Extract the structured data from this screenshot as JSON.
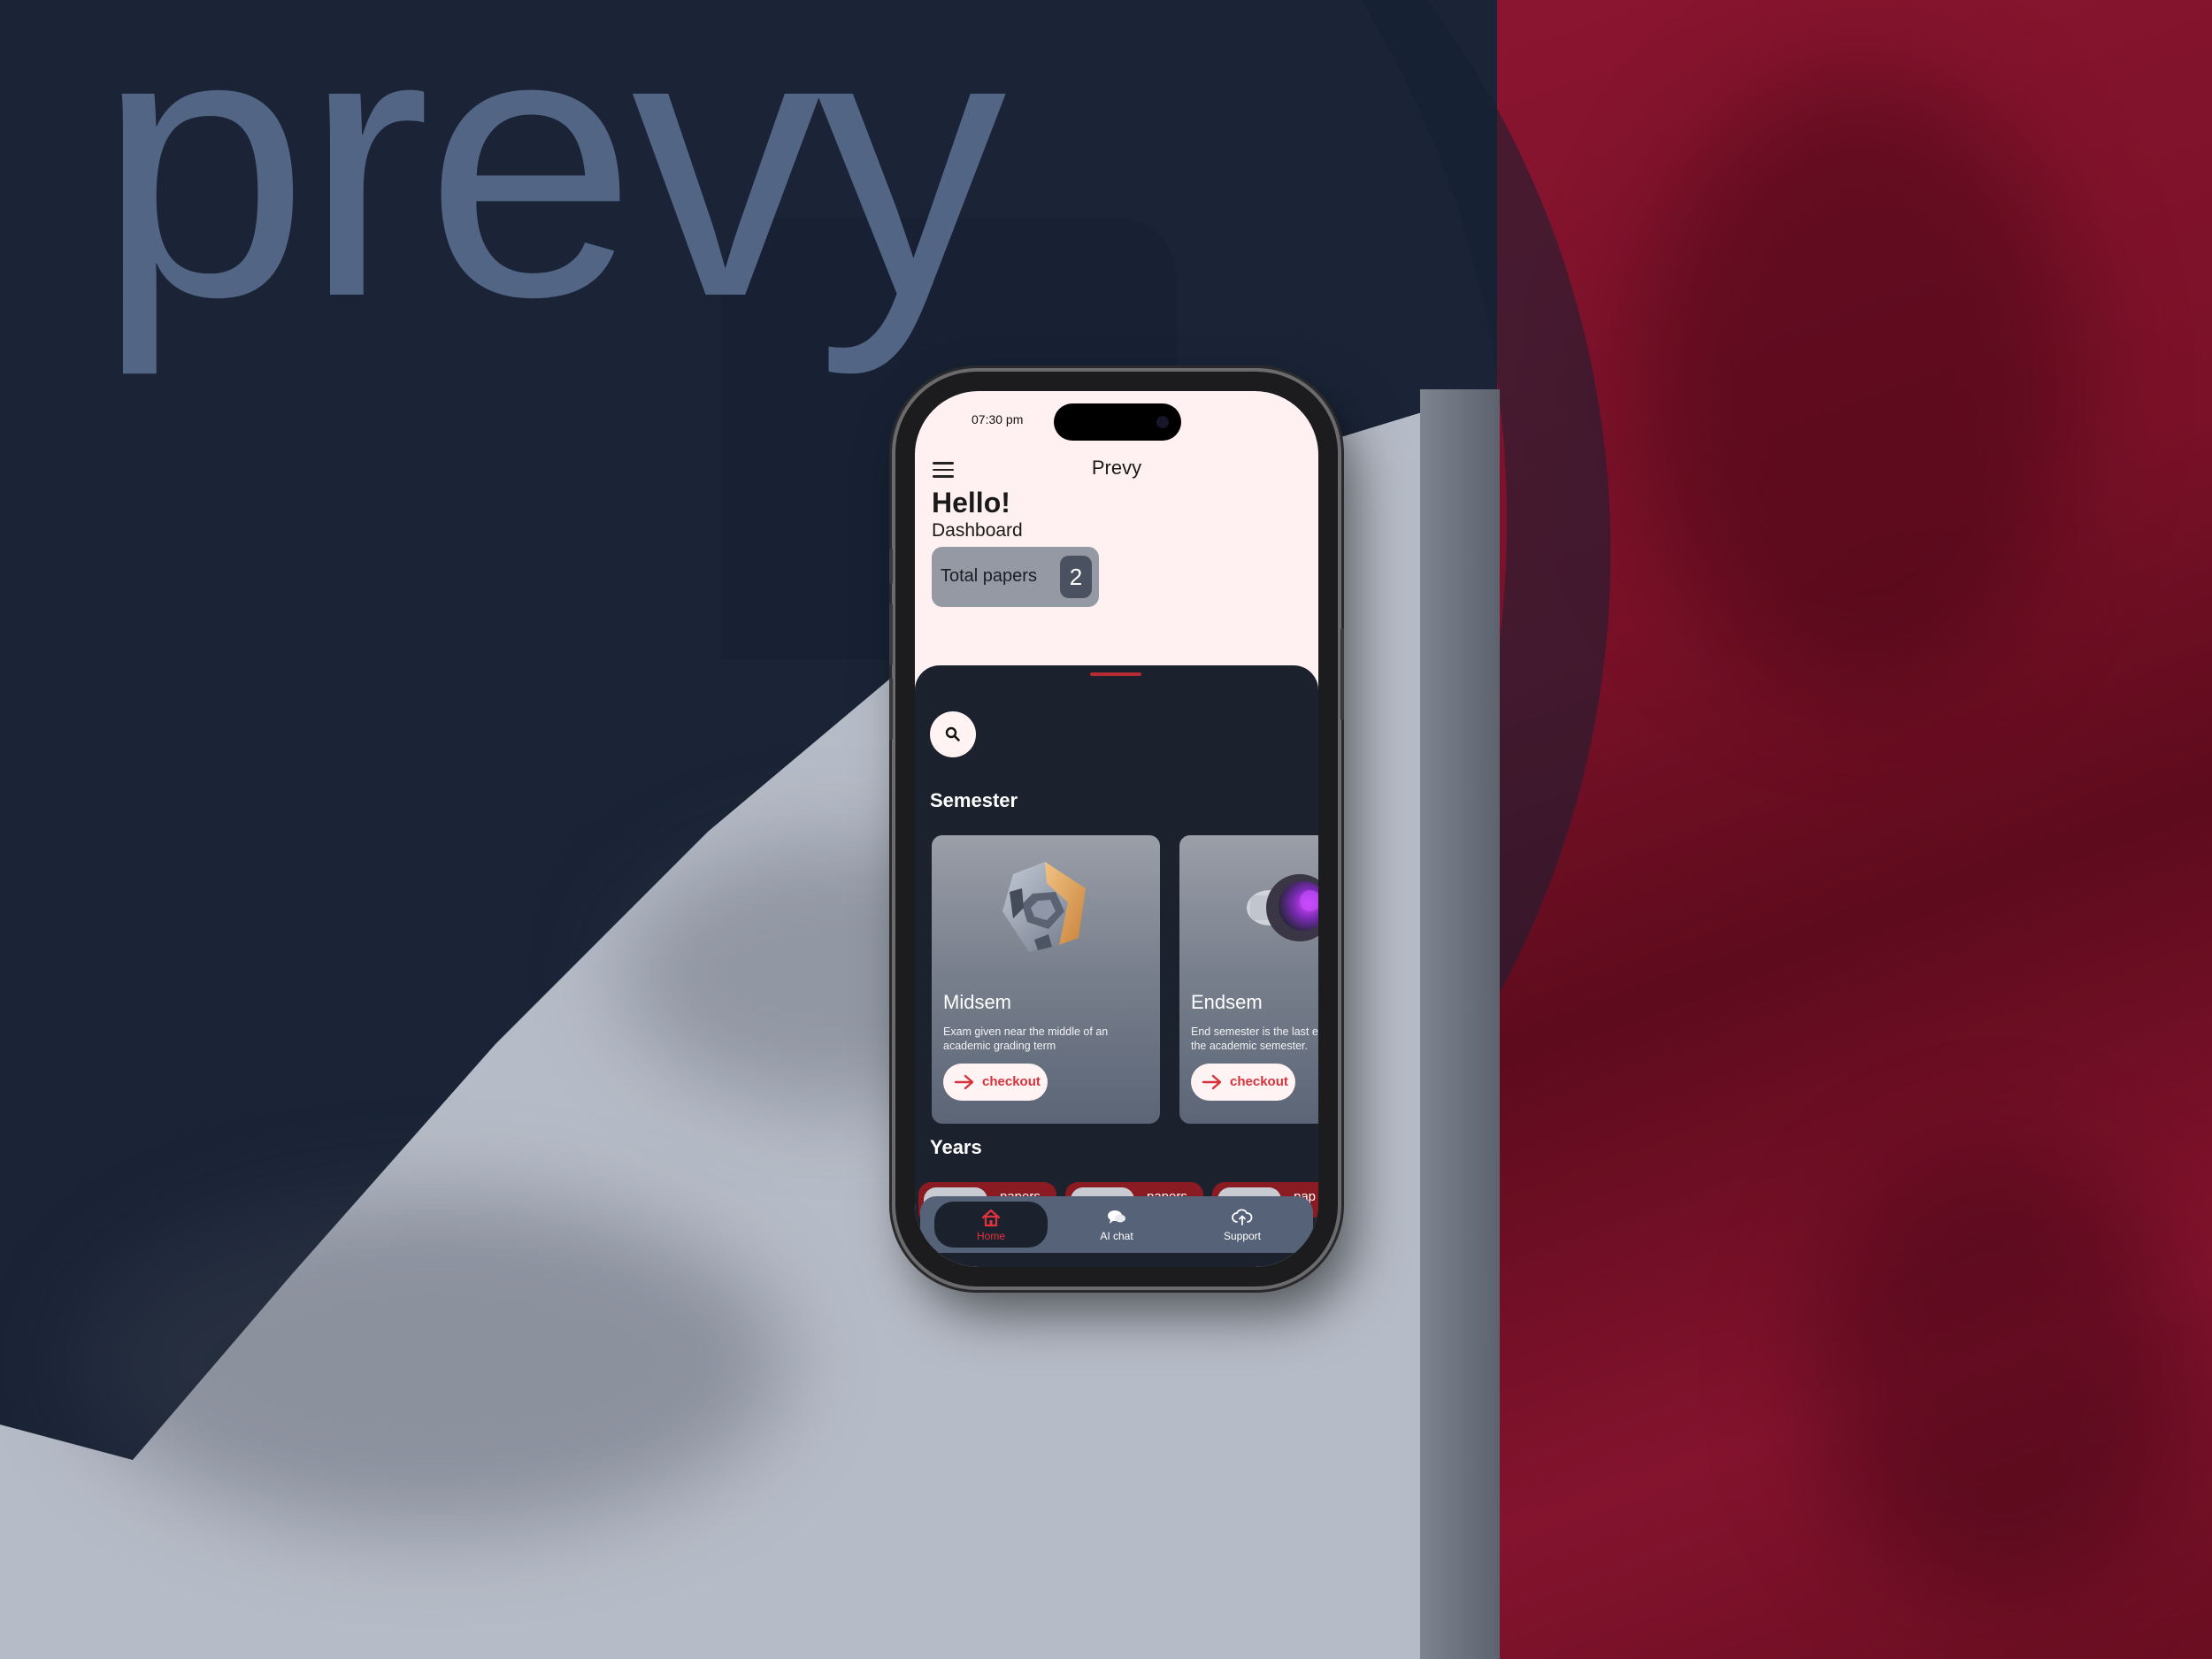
{
  "background": {
    "brand_wordmark": "prevy",
    "colors": {
      "red_wall": "#7a1128",
      "navy_wall": "#1a2436",
      "light_floor": "#b6bcc7"
    }
  },
  "status_bar": {
    "time": "07:30 pm"
  },
  "header": {
    "title": "Prevy",
    "menu_icon": "hamburger-menu-icon"
  },
  "greeting": {
    "hello": "Hello!",
    "subtitle": "Dashboard"
  },
  "stats": {
    "total_label": "Total papers",
    "total_count": "2"
  },
  "sheet": {
    "search_icon": "search-icon",
    "semester_title": "Semester",
    "years_title": "Years",
    "cards": [
      {
        "name": "Midsem",
        "desc_line1": "Exam given near the middle of an",
        "desc_line2": "academic grading term",
        "button": "checkout"
      },
      {
        "name": "Endsem",
        "desc_line1": "End semester is the last e",
        "desc_line2": "the academic semester.",
        "button": "checkout"
      }
    ],
    "years": [
      {
        "label": "papers"
      },
      {
        "label": "papers"
      },
      {
        "label": "pap"
      }
    ]
  },
  "nav": {
    "items": [
      {
        "label": "Home",
        "icon": "home-icon",
        "active": true
      },
      {
        "label": "AI chat",
        "icon": "chat-bubbles-icon",
        "active": false
      },
      {
        "label": "Support",
        "icon": "cloud-upload-icon",
        "active": false
      }
    ],
    "colors": {
      "active": "#e2333c",
      "bar": "#566277"
    }
  }
}
